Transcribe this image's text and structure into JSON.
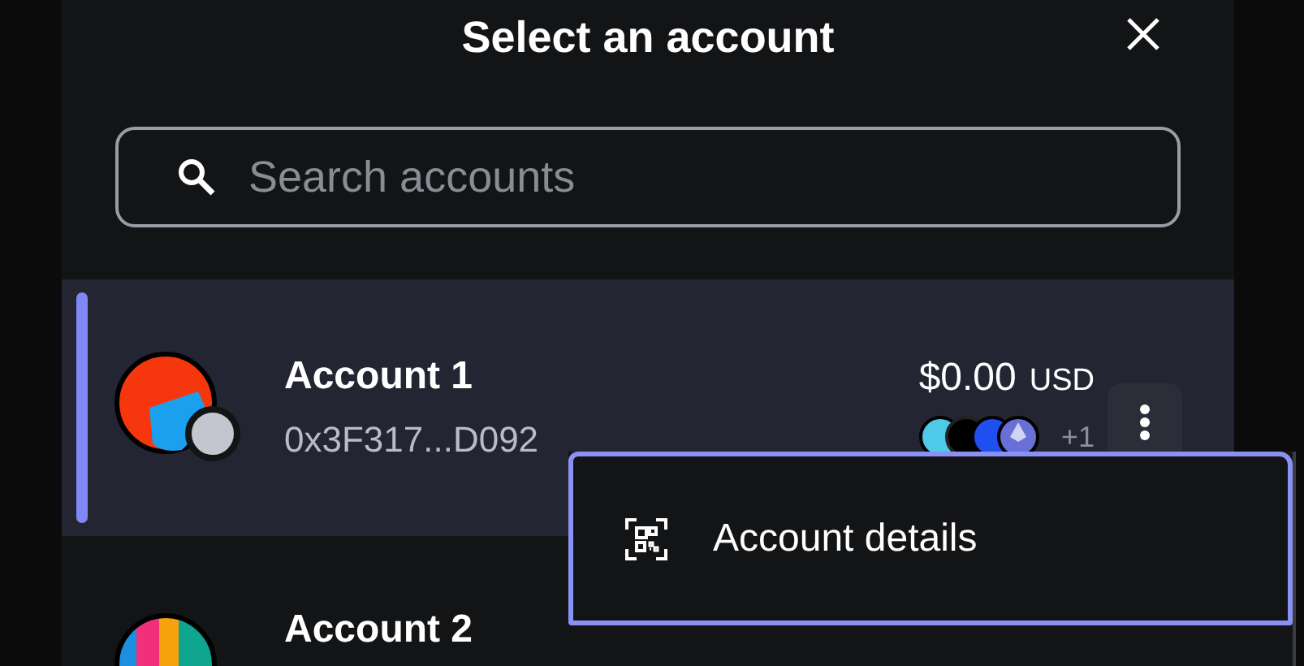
{
  "dialog": {
    "title": "Select an account"
  },
  "search": {
    "placeholder": "Search accounts"
  },
  "accounts": [
    {
      "name": "Account 1",
      "address": "0x3F317...D092",
      "balance": "$0.00",
      "currency": "USD",
      "more_tokens": "+1",
      "selected": true
    },
    {
      "name": "Account 2",
      "selected": false
    }
  ],
  "menu": {
    "items": [
      {
        "label": "Account details",
        "selected": true
      }
    ]
  }
}
